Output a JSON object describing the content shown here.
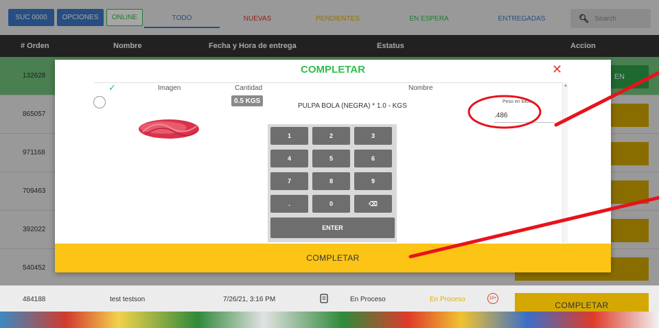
{
  "topbar": {
    "suc_label": "SUC 0000",
    "opciones_label": "OPCIONES",
    "online_label": "ONLINE",
    "tabs": [
      {
        "label": "TODO",
        "color": "#3d79c7"
      },
      {
        "label": "NUEVAS",
        "color": "#d9352f"
      },
      {
        "label": "PENDIENTES",
        "color": "#e0b100"
      },
      {
        "label": "EN ESPERA",
        "color": "#2fbf4a"
      },
      {
        "label": "ENTREGADAS",
        "color": "#3d79c7"
      }
    ],
    "search_placeholder": "Search"
  },
  "table": {
    "headers": [
      "# Orden",
      "Nombre",
      "Fecha y Hora de entrega",
      "Estatus",
      "Accion"
    ],
    "rows": [
      {
        "id": "132628",
        "action": "EN"
      },
      {
        "id": "865057",
        "action": ""
      },
      {
        "id": "971168",
        "action": ""
      },
      {
        "id": "709463",
        "action": ""
      },
      {
        "id": "392022",
        "action": ""
      },
      {
        "id": "540452",
        "action": ""
      }
    ],
    "last_row": {
      "id": "484188",
      "name": "test testson",
      "datetime": "7/26/21, 3:16 PM",
      "status": "En Proceso",
      "status_colored": "En Proceso",
      "badge": "18+",
      "action": "COMPLETAR"
    }
  },
  "modal": {
    "title": "COMPLETAR",
    "close": "✕",
    "check": "✓",
    "col_imagen": "Imagen",
    "col_cantidad": "Cantidad",
    "col_nombre": "Nombre",
    "quantity_badge": "0.5 KGS",
    "product_name": "PULPA BOLA (NEGRA) * 1.0 - KGS",
    "peso_label": "Peso en kilos",
    "peso_value": ".486",
    "keypad": {
      "k1": "1",
      "k2": "2",
      "k3": "3",
      "k4": "4",
      "k5": "5",
      "k6": "6",
      "k7": "7",
      "k8": "8",
      "k9": "9",
      "kdot": ".",
      "k0": "0",
      "kback": "⌫",
      "enter": "ENTER"
    },
    "complete_button": "COMPLETAR"
  },
  "colors": {
    "primary": "#3d79c7",
    "success": "#2fbf4a",
    "warning": "#fcc414",
    "danger": "#e03b2a"
  }
}
